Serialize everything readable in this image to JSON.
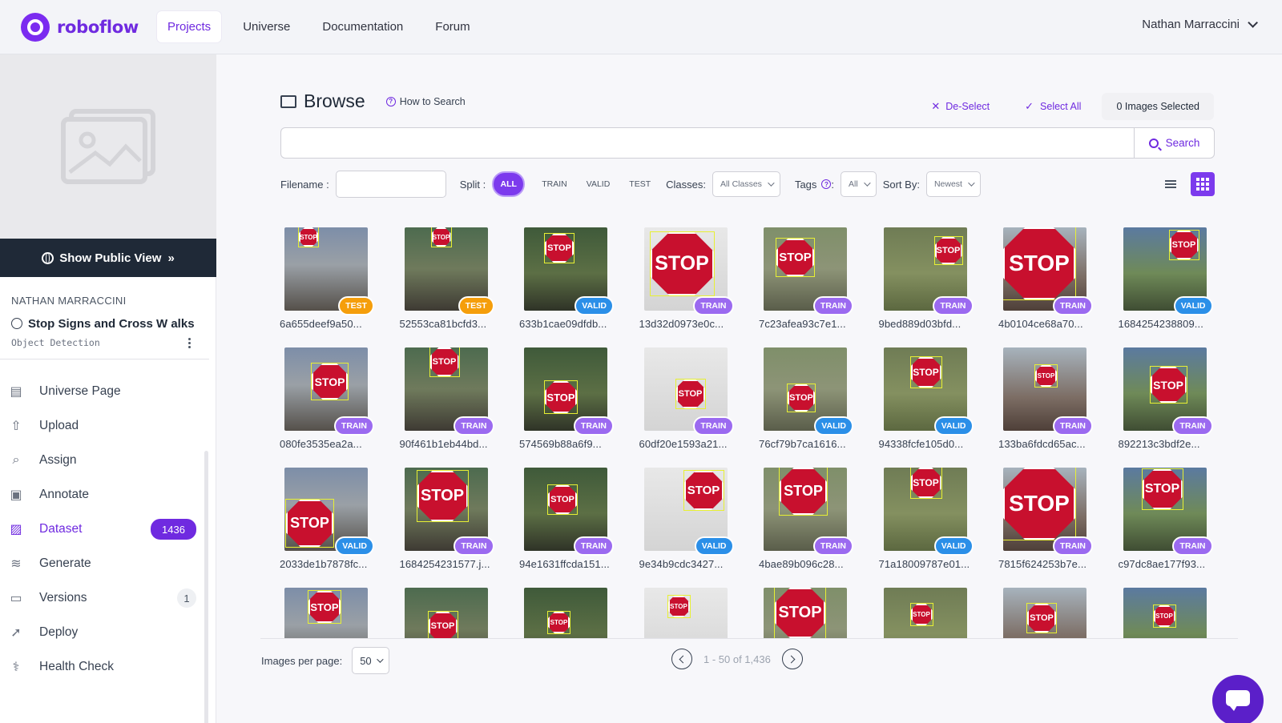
{
  "brand": {
    "name": "roboflow",
    "color": "#6f2ae0"
  },
  "nav": {
    "items": [
      {
        "label": "Projects",
        "active": true
      },
      {
        "label": "Universe",
        "active": false
      },
      {
        "label": "Documentation",
        "active": false
      },
      {
        "label": "Forum",
        "active": false
      }
    ],
    "user": "Nathan Marraccini"
  },
  "sidebar": {
    "public_view": "Show Public View",
    "owner": "NATHAN MARRACCINI",
    "project_name": "Stop Signs and Cross W alks",
    "project_type": "Object Detection",
    "menu": [
      {
        "label": "Universe Page",
        "icon": "page-icon"
      },
      {
        "label": "Upload",
        "icon": "upload-icon"
      },
      {
        "label": "Assign",
        "icon": "search-icon"
      },
      {
        "label": "Annotate",
        "icon": "annotate-icon"
      },
      {
        "label": "Dataset",
        "icon": "dataset-icon",
        "active": true,
        "count": "1436"
      },
      {
        "label": "Generate",
        "icon": "generate-icon"
      },
      {
        "label": "Versions",
        "icon": "folder-icon",
        "count": "1"
      },
      {
        "label": "Deploy",
        "icon": "rocket-icon"
      },
      {
        "label": "Health Check",
        "icon": "stethoscope-icon"
      }
    ]
  },
  "browse": {
    "title": "Browse",
    "how_to_search": "How to Search",
    "deselect": "De-Select",
    "select_all": "Select All",
    "selected_count": "0 Images Selected",
    "search_placeholder": "",
    "search_button": "Search"
  },
  "filters": {
    "filename_label": "Filename :",
    "split_label": "Split :",
    "splits": [
      "ALL",
      "TRAIN",
      "VALID",
      "TEST"
    ],
    "active_split": "ALL",
    "classes_label": "Classes:",
    "classes_value": "All Classes",
    "tags_label": "Tags",
    "tags_colon": ":",
    "tags_value": "All",
    "sort_label": "Sort By:",
    "sort_value": "Newest"
  },
  "images": [
    {
      "name": "6a655deef9a50...",
      "split": "TEST"
    },
    {
      "name": "52553ca81bcfd3...",
      "split": "TEST"
    },
    {
      "name": "633b1cae09dfdb...",
      "split": "VALID"
    },
    {
      "name": "13d32d0973e0c...",
      "split": "TRAIN"
    },
    {
      "name": "7c23afea93c7e1...",
      "split": "TRAIN"
    },
    {
      "name": "9bed889d03bfd...",
      "split": "TRAIN"
    },
    {
      "name": "4b0104ce68a70...",
      "split": "TRAIN"
    },
    {
      "name": "1684254238809...",
      "split": "VALID"
    },
    {
      "name": "080fe3535ea2a...",
      "split": "TRAIN"
    },
    {
      "name": "90f461b1eb44bd...",
      "split": "TRAIN"
    },
    {
      "name": "574569b88a6f9...",
      "split": "TRAIN"
    },
    {
      "name": "60df20e1593a21...",
      "split": "TRAIN"
    },
    {
      "name": "76cf79b7ca1616...",
      "split": "VALID"
    },
    {
      "name": "94338fcfe105d0...",
      "split": "VALID"
    },
    {
      "name": "133ba6fdcd65ac...",
      "split": "TRAIN"
    },
    {
      "name": "892213c3bdf2e...",
      "split": "TRAIN"
    },
    {
      "name": "2033de1b7878fc...",
      "split": "VALID"
    },
    {
      "name": "1684254231577.j...",
      "split": "TRAIN"
    },
    {
      "name": "94e1631ffcda151...",
      "split": "TRAIN"
    },
    {
      "name": "9e34b9cdc3427...",
      "split": "VALID"
    },
    {
      "name": "4bae89b096c28...",
      "split": "TRAIN"
    },
    {
      "name": "71a18009787e01...",
      "split": "VALID"
    },
    {
      "name": "7815f624253b7e...",
      "split": "TRAIN"
    },
    {
      "name": "c97dc8ae177f93...",
      "split": "TRAIN"
    },
    {
      "name": "",
      "split": ""
    },
    {
      "name": "",
      "split": ""
    },
    {
      "name": "",
      "split": ""
    },
    {
      "name": "",
      "split": ""
    },
    {
      "name": "",
      "split": ""
    },
    {
      "name": "",
      "split": ""
    },
    {
      "name": "",
      "split": ""
    },
    {
      "name": "",
      "split": ""
    }
  ],
  "sign_text": "STOP",
  "pagination": {
    "per_page_label": "Images per page:",
    "per_page_value": "50",
    "range": "1 - 50 of 1,436"
  },
  "colors": {
    "accent": "#7c3aed",
    "test_badge": "#f59e0b",
    "train_badge": "#9b6af0",
    "valid_badge": "#2b8fe8",
    "sidebar_dark": "#1f2937"
  }
}
